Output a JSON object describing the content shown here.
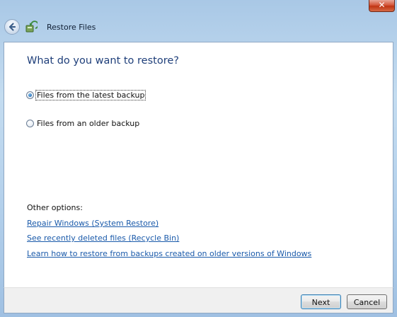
{
  "window": {
    "title": "Restore Files",
    "close_glyph": "✕",
    "accent_color": "#1f3f7a",
    "link_color": "#1a5aaa"
  },
  "main": {
    "heading": "What do you want to restore?",
    "options": [
      {
        "label": "Files from the latest backup",
        "selected": true
      },
      {
        "label": "Files from an older backup",
        "selected": false
      }
    ],
    "other_options_label": "Other options:",
    "links": [
      "Repair Windows (System Restore)",
      "See recently deleted files (Recycle Bin)",
      "Learn how to restore from backups created on older versions of Windows"
    ]
  },
  "footer": {
    "next_label": "Next",
    "cancel_label": "Cancel"
  }
}
